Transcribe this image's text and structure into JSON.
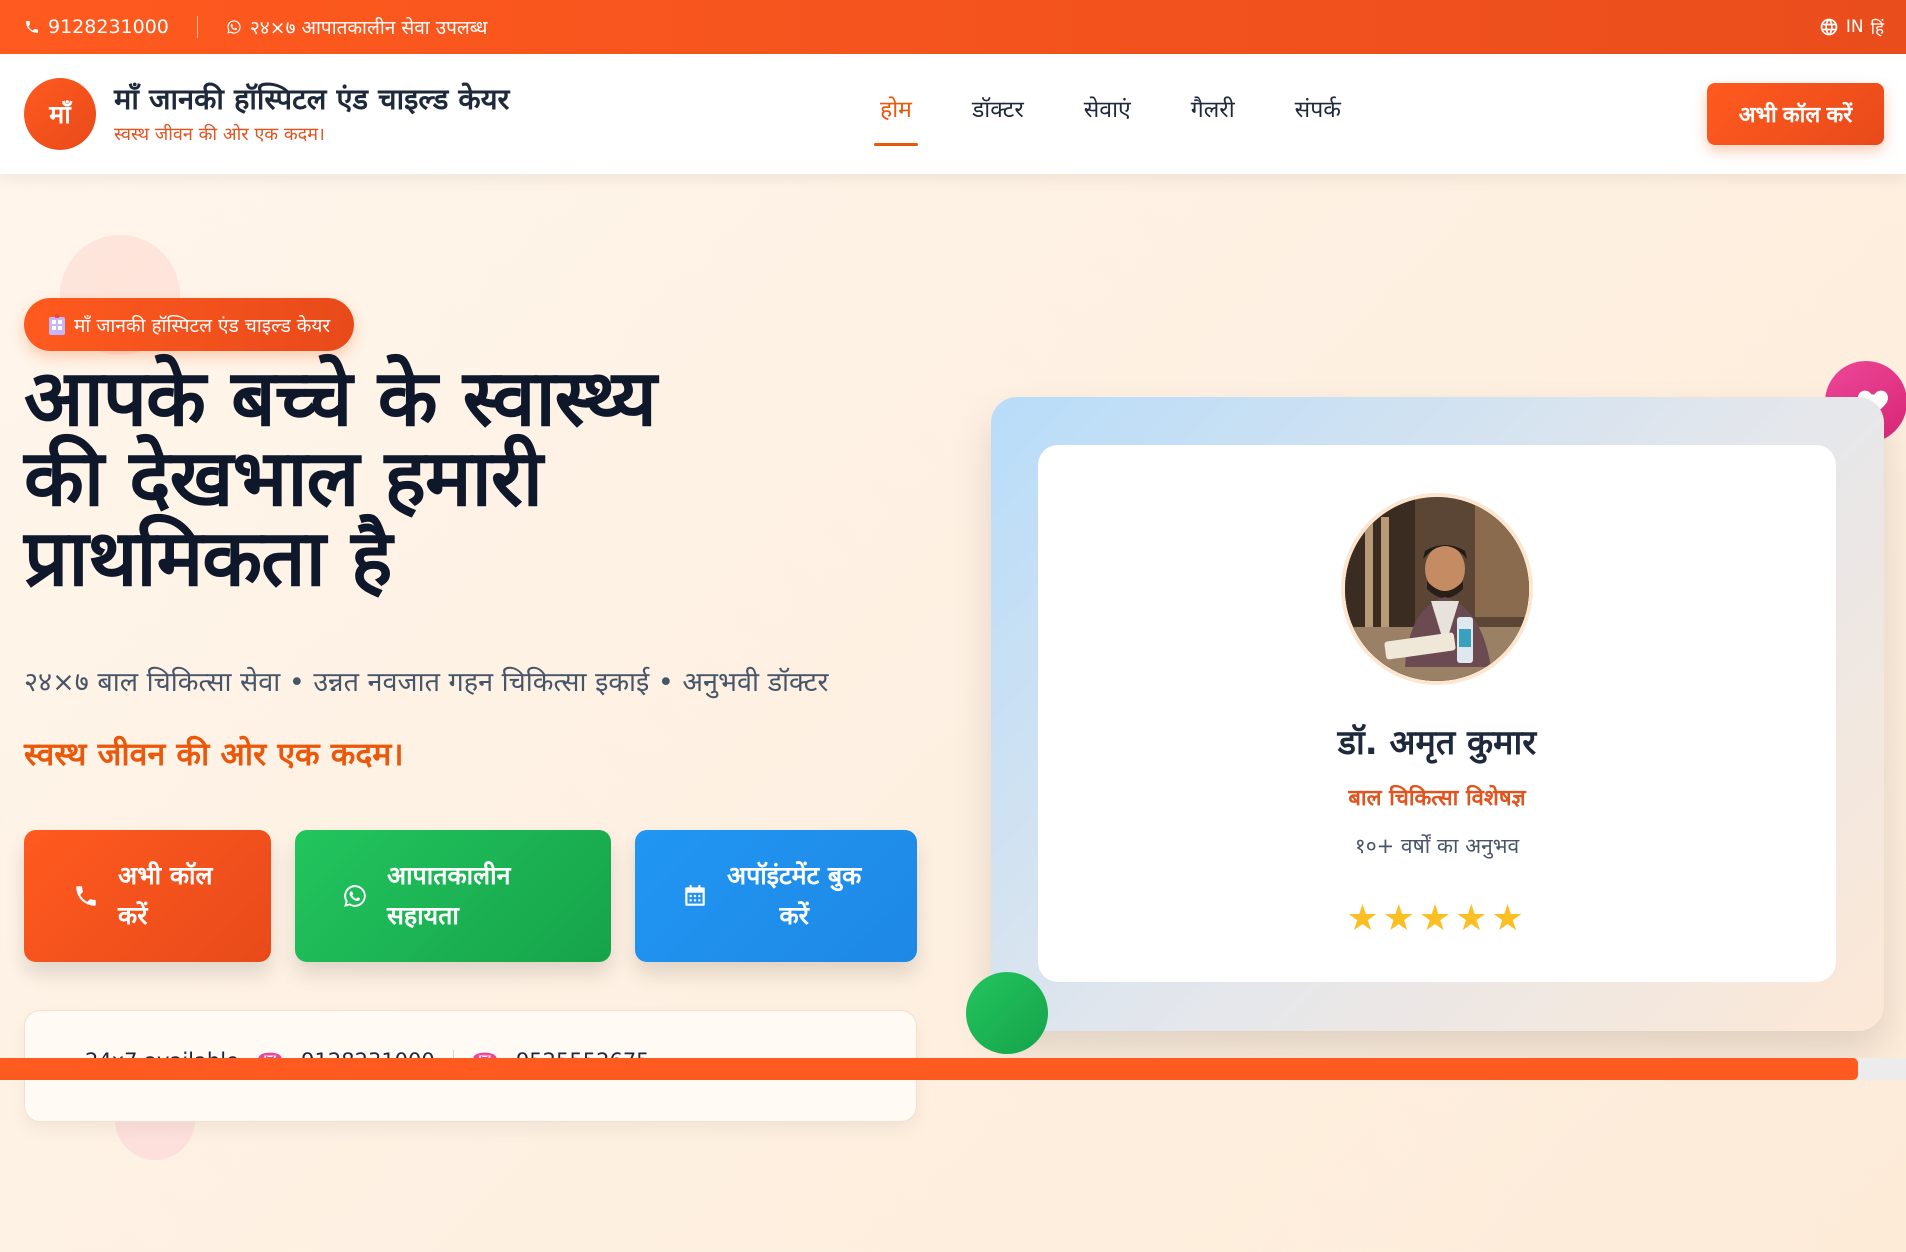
{
  "topbar": {
    "phone": "9128231000",
    "emergency": "२४×७ आपातकालीन सेवा उपलब्ध",
    "lang_code": "IN",
    "lang_label": "हिं"
  },
  "header": {
    "logo_text": "माँ",
    "brand_name": "माँ जानकी हॉस्पिटल एंड चाइल्ड केयर",
    "brand_tagline": "स्वस्थ जीवन की ओर एक कदम।",
    "nav": [
      {
        "label": "होम",
        "active": true
      },
      {
        "label": "डॉक्टर"
      },
      {
        "label": "सेवाएं"
      },
      {
        "label": "गैलरी"
      },
      {
        "label": "संपर्क"
      }
    ],
    "call_label": "अभी कॉल करें"
  },
  "hero": {
    "badge_icon": "hospital-emoji",
    "badge": "माँ जानकी हॉस्पिटल एंड चाइल्ड केयर",
    "title_lines": [
      "आपके बच्चे के स्वास्थ्य",
      "की देखभाल हमारी",
      "प्राथमिकता है"
    ],
    "subtitle": "२४×७ बाल चिकित्सा सेवा • उन्नत नवजात गहन चिकित्सा इकाई • अनुभवी डॉक्टर",
    "slogan": "स्वस्थ जीवन की ओर एक कदम।",
    "cta": {
      "call": {
        "line1": "अभी कॉल",
        "line2": "करें"
      },
      "emergency": {
        "line1": "आपातकालीन",
        "line2": "सहायता"
      },
      "appointment": {
        "line1": "अपॉइंटमेंट बुक",
        "line2": "करें"
      }
    },
    "info_card": {
      "availability": "24x7 available",
      "phone1": "9128231000",
      "phone2": "9525552675"
    },
    "progress_percent": 97.5
  },
  "doctor": {
    "name": "डॉ. अमृत कुमार",
    "specialty": "बाल चिकित्सा विशेषज्ञ",
    "experience": "१०+ वर्षों का अनुभव",
    "stars": "★★★★★",
    "rating": 5
  },
  "colors": {
    "primary": "#ff5a1f",
    "green": "#22c55e",
    "blue": "#2196f3",
    "pink": "#ec4899",
    "star": "#fbbf24"
  }
}
